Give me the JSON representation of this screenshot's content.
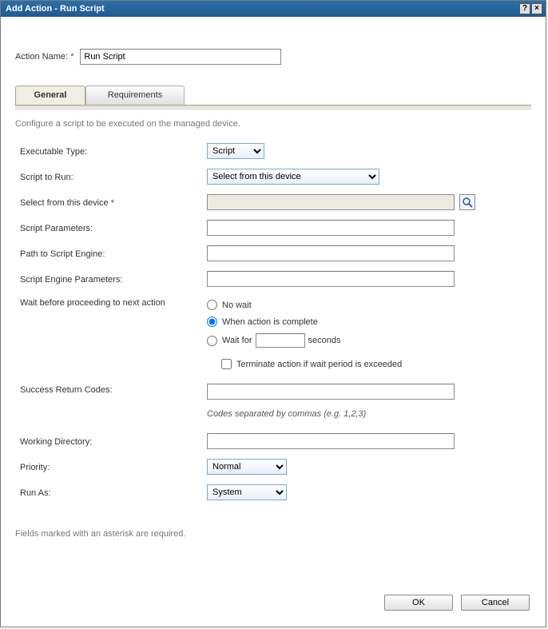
{
  "titlebar": {
    "title": "Add Action - Run Script",
    "help_label": "?",
    "close_label": "×"
  },
  "action_name": {
    "label": "Action Name:",
    "asterisk": "*",
    "value": "Run Script"
  },
  "tabs": {
    "general": "General",
    "requirements": "Requirements"
  },
  "description": "Configure a script to be executed on the managed device.",
  "form": {
    "executable_type": {
      "label": "Executable Type:",
      "value": "Script"
    },
    "script_to_run": {
      "label": "Script to Run:",
      "value": "Select from this device"
    },
    "select_device": {
      "label": "Select from this device",
      "asterisk": "*"
    },
    "script_parameters": {
      "label": "Script Parameters:",
      "value": ""
    },
    "path_engine": {
      "label": "Path to Script Engine:",
      "value": ""
    },
    "engine_parameters": {
      "label": "Script Engine Parameters:",
      "value": ""
    },
    "wait": {
      "label": "Wait before proceeding to next action",
      "no_wait": "No wait",
      "when_complete": "When action is complete",
      "wait_for": "Wait for",
      "seconds": "seconds",
      "wait_seconds_value": "",
      "terminate": "Terminate action if wait period is exceeded"
    },
    "success_codes": {
      "label": "Success Return Codes:",
      "value": "",
      "hint": "Codes separated by commas (e.g. 1,2,3)"
    },
    "working_dir": {
      "label": "Working Directory:",
      "value": ""
    },
    "priority": {
      "label": "Priority:",
      "value": "Normal"
    },
    "run_as": {
      "label": "Run As:",
      "value": "System"
    }
  },
  "footer_note": "Fields marked with an asterisk are required.",
  "buttons": {
    "ok": "OK",
    "cancel": "Cancel"
  },
  "icons": {
    "search": "search-icon"
  }
}
